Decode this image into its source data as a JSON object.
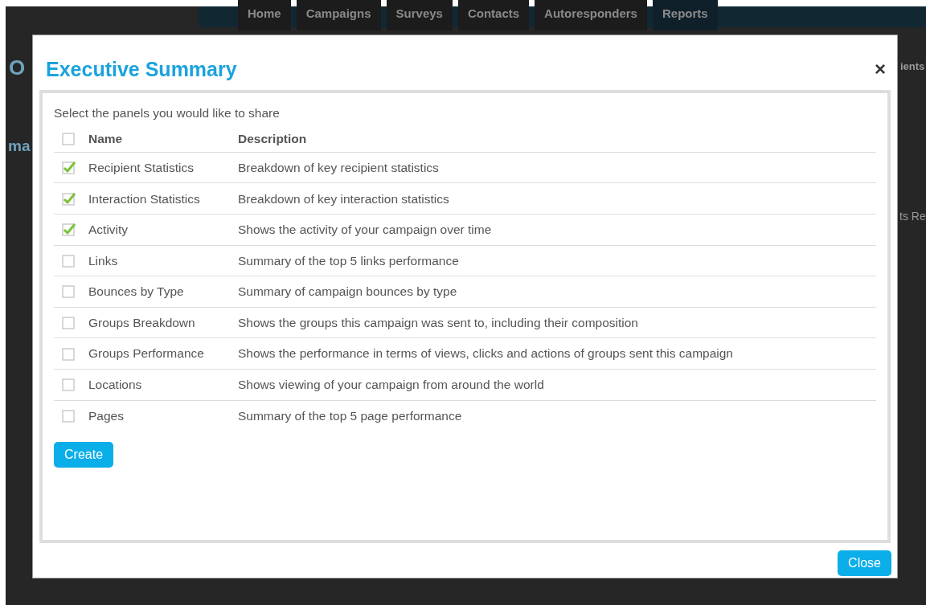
{
  "background": {
    "nav": [
      {
        "label": "Home",
        "selected": false
      },
      {
        "label": "Campaigns",
        "selected": false
      },
      {
        "label": "Surveys",
        "selected": false
      },
      {
        "label": "Contacts",
        "selected": false
      },
      {
        "label": "Autoresponders",
        "selected": false
      },
      {
        "label": "Reports",
        "selected": true
      }
    ],
    "fragments_left": [
      "O",
      "ma"
    ],
    "fragments_right": [
      "ients",
      "ts Re"
    ]
  },
  "dialog": {
    "title": "Executive Summary",
    "close_symbol": "×",
    "intro": "Select the panels you would like to share",
    "select_all_checked": false,
    "columns": [
      "Name",
      "Description"
    ],
    "rows": [
      {
        "name": "Recipient Statistics",
        "description": "Breakdown of key recipient statistics",
        "checked": true
      },
      {
        "name": "Interaction Statistics",
        "description": "Breakdown of key interaction statistics",
        "checked": true
      },
      {
        "name": "Activity",
        "description": "Shows the activity of your campaign over time",
        "checked": true
      },
      {
        "name": "Links",
        "description": "Summary of the top 5 links performance",
        "checked": false
      },
      {
        "name": "Bounces by Type",
        "description": "Summary of campaign bounces by type",
        "checked": false
      },
      {
        "name": "Groups Breakdown",
        "description": "Shows the groups this campaign was sent to, including their composition",
        "checked": false
      },
      {
        "name": "Groups Performance",
        "description": "Shows the performance in terms of views, clicks and actions of groups sent this campaign",
        "checked": false
      },
      {
        "name": "Locations",
        "description": "Shows viewing of your campaign from around the world",
        "checked": false
      },
      {
        "name": "Pages",
        "description": "Summary of the top 5 page performance",
        "checked": false
      }
    ],
    "create_label": "Create",
    "close_label": "Close"
  }
}
